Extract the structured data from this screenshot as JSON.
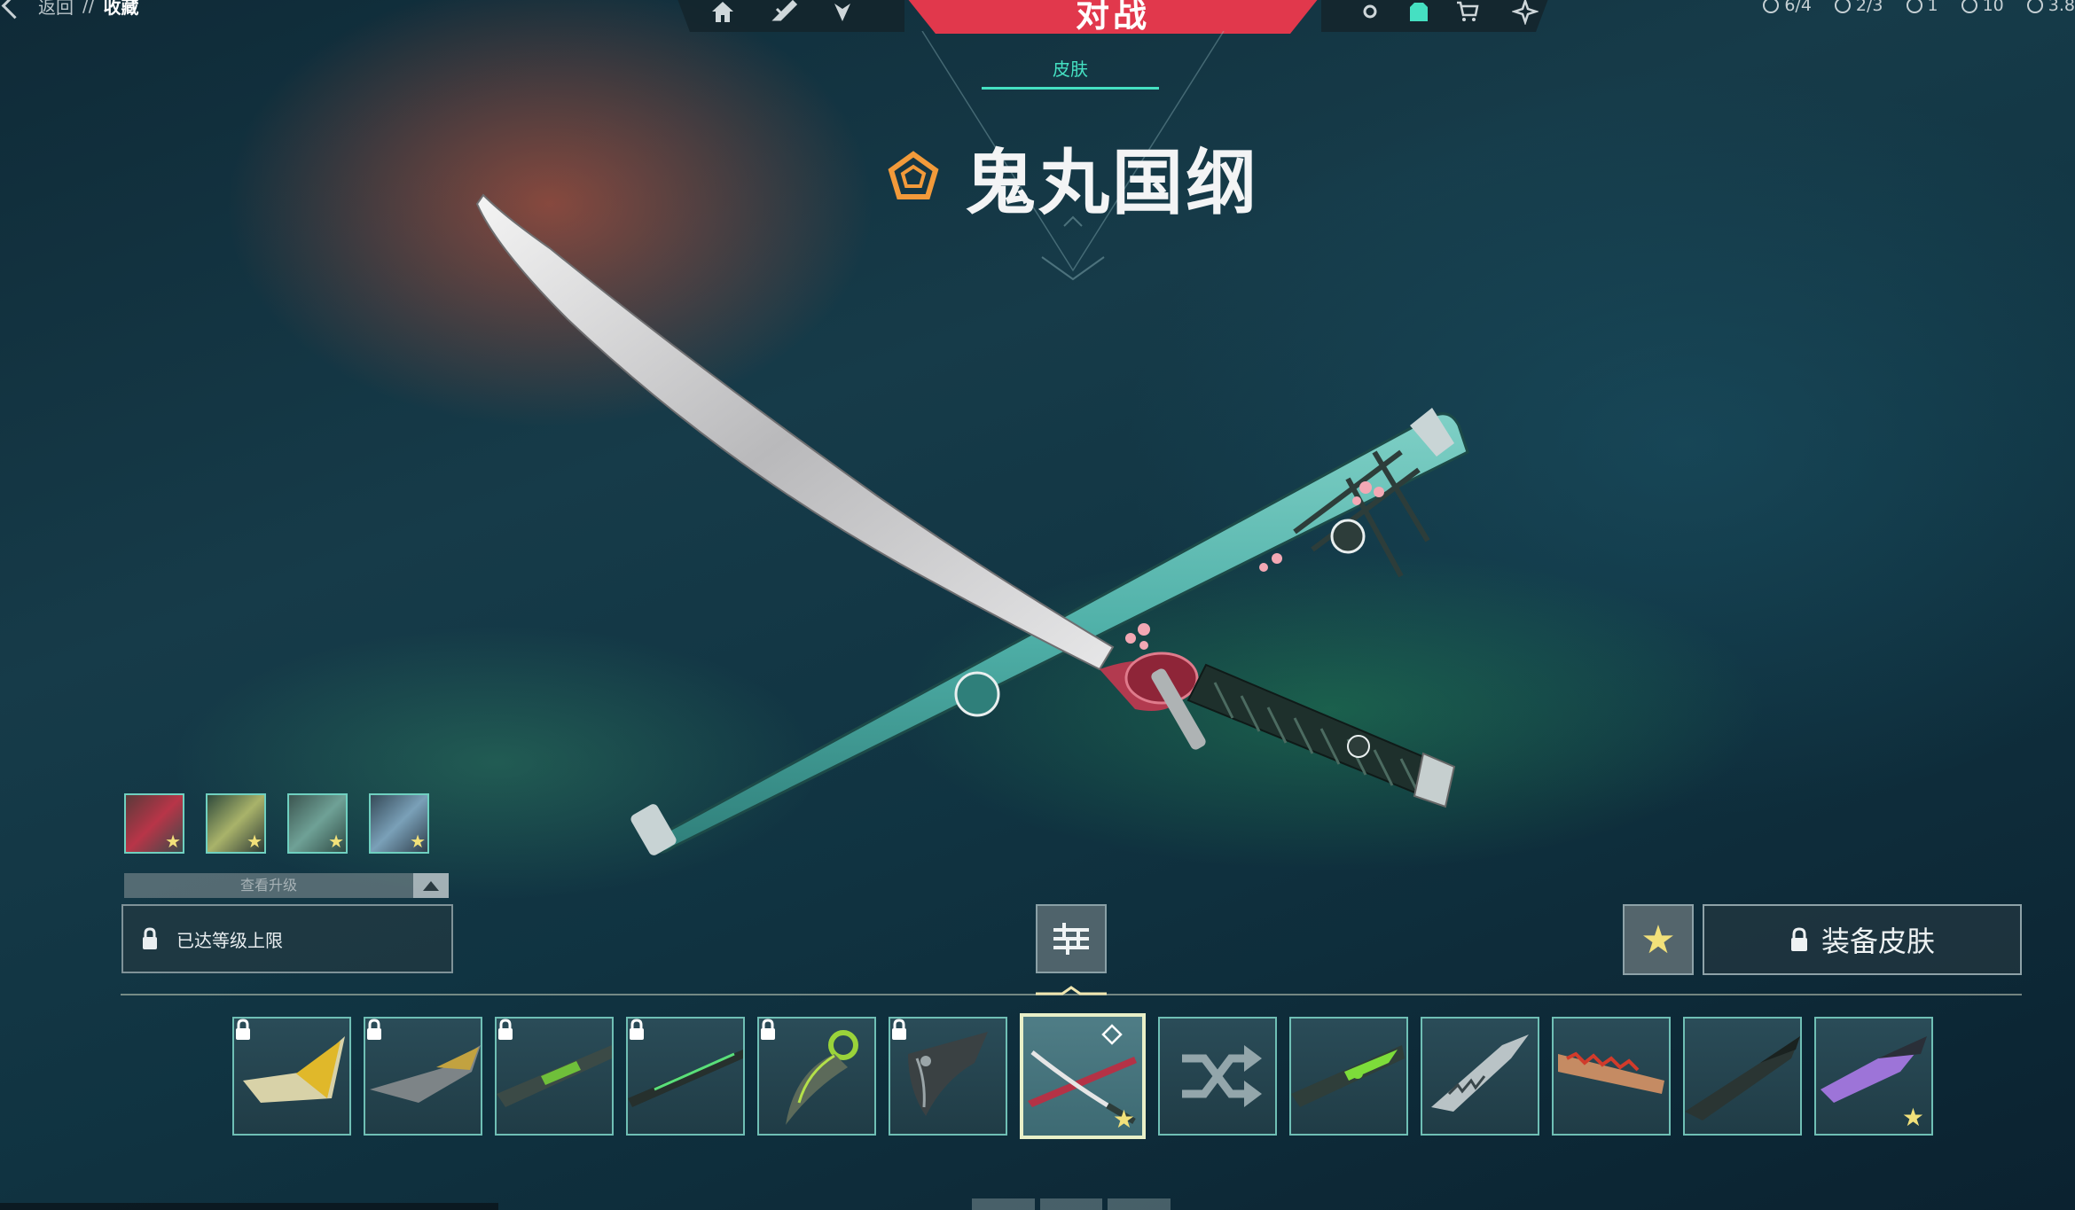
{
  "breadcrumb": {
    "back": "返回",
    "separator": "//",
    "current": "收藏"
  },
  "top_nav": {
    "active_tab": "对战"
  },
  "currency": {
    "agents": "6/4",
    "contracts": "2/3",
    "radianite": "1",
    "valorant_points": "10",
    "kingdom_credits": "3.8"
  },
  "skin": {
    "category": "皮肤",
    "name": "鬼丸国纲"
  },
  "upgrade": {
    "label": "查看升级",
    "status": "已达等级上限"
  },
  "actions": {
    "equip": "装备皮肤"
  },
  "colors": {
    "accent": "#e1384c",
    "teal": "#45e0c2",
    "favorite": "#f2e17a",
    "tier": "#f29a3a"
  },
  "variants": [
    {
      "name": "variant-1",
      "favorite": true
    },
    {
      "name": "variant-2",
      "favorite": true
    },
    {
      "name": "variant-3",
      "favorite": true
    },
    {
      "name": "variant-4",
      "favorite": true
    }
  ],
  "skins": [
    {
      "name": "yellow-blade",
      "locked": true
    },
    {
      "name": "tactical-knife",
      "locked": true
    },
    {
      "name": "green-rail-blade",
      "locked": true
    },
    {
      "name": "neon-blade",
      "locked": true
    },
    {
      "name": "karambit",
      "locked": true
    },
    {
      "name": "dark-karambit",
      "locked": true
    },
    {
      "name": "onimaru-kunitsuna",
      "selected": true,
      "favorite": true
    },
    {
      "name": "random-shuffle"
    },
    {
      "name": "green-tech-knife"
    },
    {
      "name": "serrated-blade"
    },
    {
      "name": "orange-teeth-knife"
    },
    {
      "name": "standard-knife"
    },
    {
      "name": "purple-crystal-knife",
      "favorite": true
    }
  ]
}
